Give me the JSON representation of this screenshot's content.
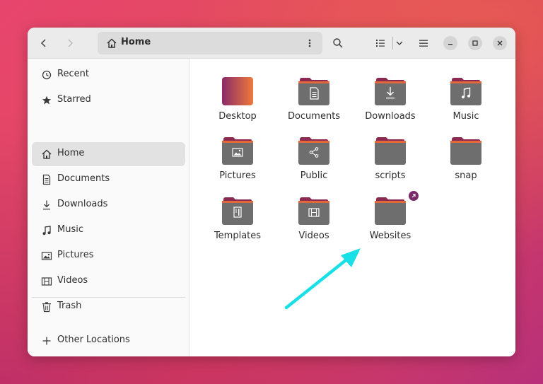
{
  "window": {
    "location_label": "Home",
    "icons": {
      "back": "chevron-left-icon",
      "forward": "chevron-right-icon",
      "location": "home-icon",
      "path_menu": "vertical-dots-icon",
      "search": "search-icon",
      "view": "list-view-icon",
      "view_options": "chevron-down-icon",
      "main_menu": "hamburger-menu-icon",
      "minimize": "minimize-icon",
      "maximize": "maximize-icon",
      "close": "close-icon"
    }
  },
  "sidebar": {
    "items": [
      {
        "label": "Recent",
        "icon": "clock-icon",
        "selected": false
      },
      {
        "label": "Starred",
        "icon": "star-icon",
        "selected": false
      },
      {
        "label": "Home",
        "icon": "home-icon",
        "selected": true
      },
      {
        "label": "Documents",
        "icon": "document-icon",
        "selected": false
      },
      {
        "label": "Downloads",
        "icon": "download-icon",
        "selected": false
      },
      {
        "label": "Music",
        "icon": "music-note-icon",
        "selected": false
      },
      {
        "label": "Pictures",
        "icon": "picture-icon",
        "selected": false
      },
      {
        "label": "Videos",
        "icon": "film-icon",
        "selected": false
      },
      {
        "label": "Trash",
        "icon": "trash-icon",
        "selected": false
      }
    ],
    "other_locations": {
      "label": "Other Locations",
      "icon": "plus-icon"
    }
  },
  "folders": [
    {
      "label": "Desktop",
      "emblem": "none",
      "style": "gradient"
    },
    {
      "label": "Documents",
      "emblem": "document-icon",
      "style": "normal"
    },
    {
      "label": "Downloads",
      "emblem": "download-icon",
      "style": "normal"
    },
    {
      "label": "Music",
      "emblem": "music-note-icon",
      "style": "normal"
    },
    {
      "label": "Pictures",
      "emblem": "picture-icon",
      "style": "normal"
    },
    {
      "label": "Public",
      "emblem": "share-icon",
      "style": "normal"
    },
    {
      "label": "scripts",
      "emblem": "none",
      "style": "normal"
    },
    {
      "label": "snap",
      "emblem": "none",
      "style": "normal"
    },
    {
      "label": "Templates",
      "emblem": "template-icon",
      "style": "normal"
    },
    {
      "label": "Videos",
      "emblem": "film-icon",
      "style": "normal"
    },
    {
      "label": "Websites",
      "emblem": "none",
      "style": "normal",
      "symlink_badge": "symlink-arrow-icon"
    }
  ],
  "colors": {
    "folder_tab": "#8a2a52",
    "folder_tab_light": "#e0683a",
    "folder_body": "#6e6e6e",
    "desktop_left": "#8a2a6a",
    "desktop_right": "#ee7a3a",
    "symlink_badge": "#7a2a6a",
    "annotation_arrow": "#19e0e6"
  },
  "annotation": {
    "type": "arrow",
    "icon": "annotation-arrow",
    "points_to": "Websites"
  }
}
